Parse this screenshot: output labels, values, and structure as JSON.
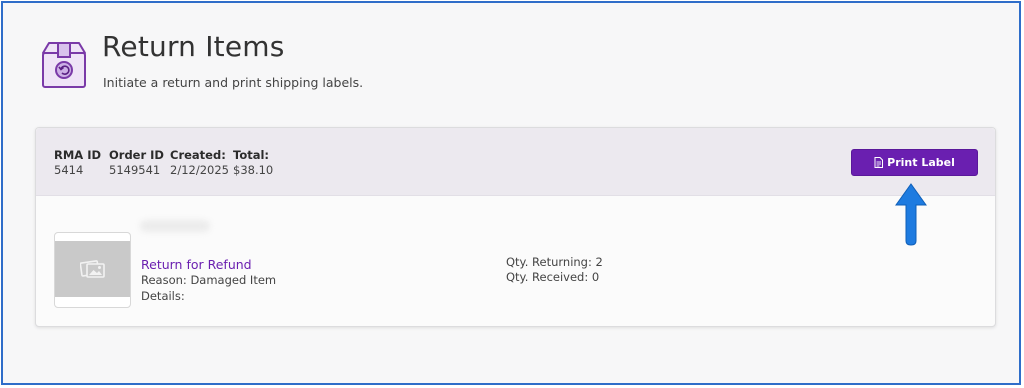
{
  "header": {
    "title": "Return Items",
    "subtitle": "Initiate a return and print shipping labels."
  },
  "rma": {
    "rma_id_label": "RMA ID",
    "rma_id": "5414",
    "order_id_label": "Order ID",
    "order_id": "5149541",
    "created_label": "Created:",
    "created": "2/12/2025",
    "total_label": "Total:",
    "total": "$38.10",
    "print_label": "Print Label"
  },
  "item": {
    "return_type": "Return for Refund",
    "reason_label": "Reason:",
    "reason": "Damaged Item",
    "details_label": "Details:",
    "qty_returning_label": "Qty. Returning:",
    "qty_returning": "2",
    "qty_received_label": "Qty. Received:",
    "qty_received": "0"
  },
  "colors": {
    "accent": "#6a1fb0",
    "annotation_arrow": "#1e7be0",
    "frame": "#2f6dc9"
  },
  "icons": {
    "header": "return-box-icon",
    "print": "document-icon",
    "placeholder": "image-placeholder-icon",
    "annotation": "arrow-up-icon"
  }
}
